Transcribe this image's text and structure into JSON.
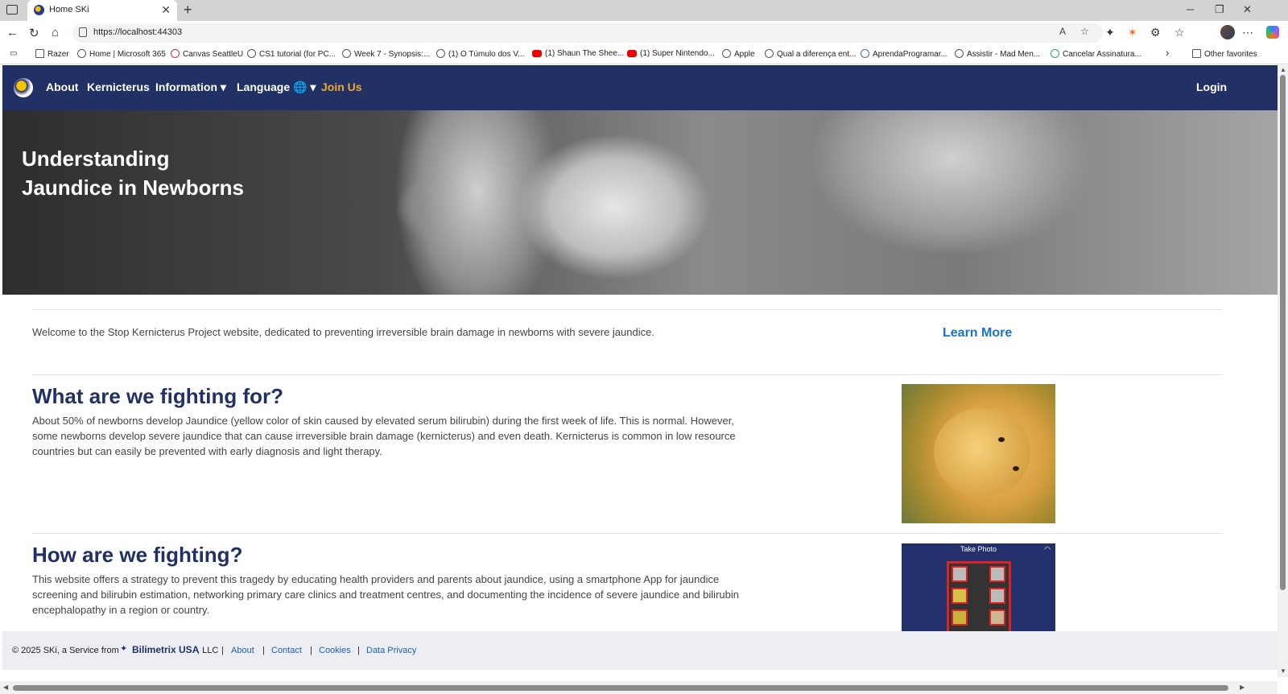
{
  "browser": {
    "tab_title": "Home SKi",
    "tab_close": "✕",
    "new_tab": "+",
    "url": "https://localhost:44303",
    "window_controls": [
      "─",
      "❐",
      "✕"
    ],
    "bookmarks": [
      {
        "label": "Razer",
        "icon": "folder-icon"
      },
      {
        "label": "Home | Microsoft 365",
        "icon": "microsoft365-icon"
      },
      {
        "label": "Canvas SeattleU",
        "icon": "canvas-icon"
      },
      {
        "label": "CS1 tutorial (for PC...",
        "icon": "globe-icon"
      },
      {
        "label": "Week 7 - Synopsis:...",
        "icon": "globe-icon"
      },
      {
        "label": "(1) O Túmulo dos V...",
        "icon": "globe-icon"
      },
      {
        "label": "(1) Shaun The Shee...",
        "icon": "youtube-icon"
      },
      {
        "label": "(1) Super Nintendo...",
        "icon": "youtube-icon"
      },
      {
        "label": "Apple",
        "icon": "globe-icon"
      },
      {
        "label": "Qual a diferença ent...",
        "icon": "globe-icon"
      },
      {
        "label": "AprendaProgramar...",
        "icon": "python-icon"
      },
      {
        "label": "Assistir - Mad Men...",
        "icon": "globe-icon"
      },
      {
        "label": "Cancelar Assinatura...",
        "icon": "site-icon"
      }
    ],
    "bookmarks_more": "›",
    "other_favorites": "Other favorites"
  },
  "navbar": {
    "about": "About",
    "kernicterus": "Kernicterus",
    "information": "Information ▾",
    "language": "Language 🌐 ▾",
    "join": "Join Us",
    "login": "Login"
  },
  "hero": {
    "title": "Understanding\nJaundice in Newborns"
  },
  "welcome": {
    "text": "Welcome to the Stop Kernicterus Project website, dedicated to preventing irreversible brain damage in newborns with severe jaundice.",
    "learn_more": "Learn More"
  },
  "sections": [
    {
      "heading": "What are we fighting for?",
      "body": "About 50% of newborns develop Jaundice (yellow color of skin caused by elevated serum bilirubin) during the first week of life. This is normal. However, some newborns develop severe jaundice that can cause irreversible brain damage (kernicterus) and even death. Kernicterus is common in low resource countries but can easily be prevented with early diagnosis and light therapy."
    },
    {
      "heading": "How are we fighting?",
      "body": "This website offers a strategy to prevent this tragedy by educating health providers and parents about jaundice, using a smartphone App for jaundice screening and bilirubin estimation, networking primary care clinics and treatment centres, and documenting the incidence of severe jaundice and bilirubin encephalopathy in a region or country.",
      "image_label": "Take Photo"
    }
  ],
  "footer": {
    "copyright": "© 2025 SKi, a Service from",
    "brand": "Bilimetrix USA",
    "suffix": ", LLC",
    "sep": "|",
    "links": [
      "About",
      "Contact",
      "Cookies",
      "Data Privacy"
    ]
  },
  "colors": {
    "navbar": "#213166",
    "join": "#f0a830",
    "heading": "#213166",
    "link": "#1a73c8"
  }
}
